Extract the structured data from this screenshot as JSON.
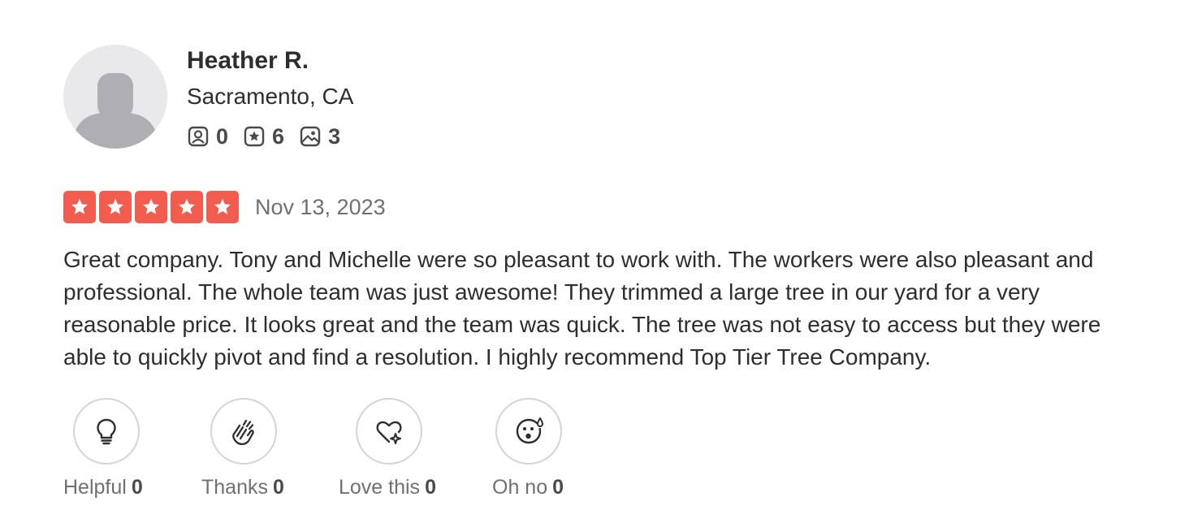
{
  "user": {
    "name": "Heather R.",
    "location": "Sacramento, CA",
    "stats": [
      {
        "icon": "friends-icon",
        "count": "0"
      },
      {
        "icon": "reviews-icon",
        "count": "6"
      },
      {
        "icon": "photos-icon",
        "count": "3"
      }
    ]
  },
  "review": {
    "rating": 5,
    "rating_max": 5,
    "star_color": "#f15c4f",
    "date": "Nov 13, 2023",
    "text": "Great company. Tony and Michelle were so pleasant to work with. The workers were also pleasant and professional. The whole team was just awesome! They trimmed a large tree in our yard for a very reasonable price. It looks great and the team was quick. The tree was not easy to access but they were able to quickly pivot and find a resolution. I highly recommend Top Tier Tree Company."
  },
  "reactions": [
    {
      "icon": "lightbulb-icon",
      "label": "Helpful",
      "count": "0"
    },
    {
      "icon": "clapping-hands-icon",
      "label": "Thanks",
      "count": "0"
    },
    {
      "icon": "heart-sparkle-icon",
      "label": "Love this",
      "count": "0"
    },
    {
      "icon": "oh-no-face-icon",
      "label": "Oh no",
      "count": "0"
    }
  ]
}
